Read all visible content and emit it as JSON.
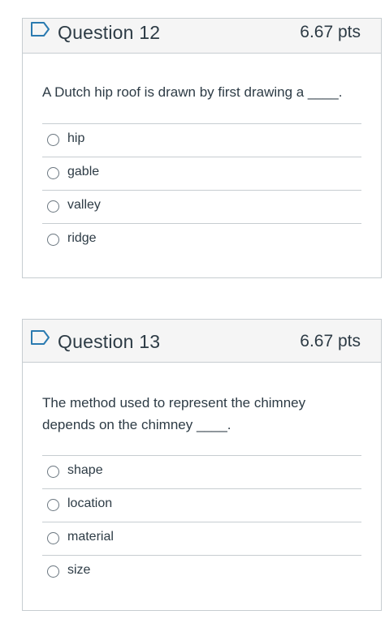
{
  "questions": [
    {
      "title": "Question 12",
      "points": "6.67 pts",
      "text": "A Dutch hip roof is drawn by first drawing a ____.",
      "answers": [
        "hip",
        "gable",
        "valley",
        "ridge"
      ]
    },
    {
      "title": "Question 13",
      "points": "6.67 pts",
      "text": "The method used to represent the chimney depends on the chimney ____.",
      "answers": [
        "shape",
        "location",
        "material",
        "size"
      ]
    }
  ],
  "colors": {
    "flag_icon": "#2a7ab0",
    "header_bg": "#f5f5f5",
    "border": "#c7cdd1",
    "text": "#2d3b45"
  },
  "icons": {
    "flag": "flag-question-icon",
    "radio": "radio-unselected-icon"
  }
}
